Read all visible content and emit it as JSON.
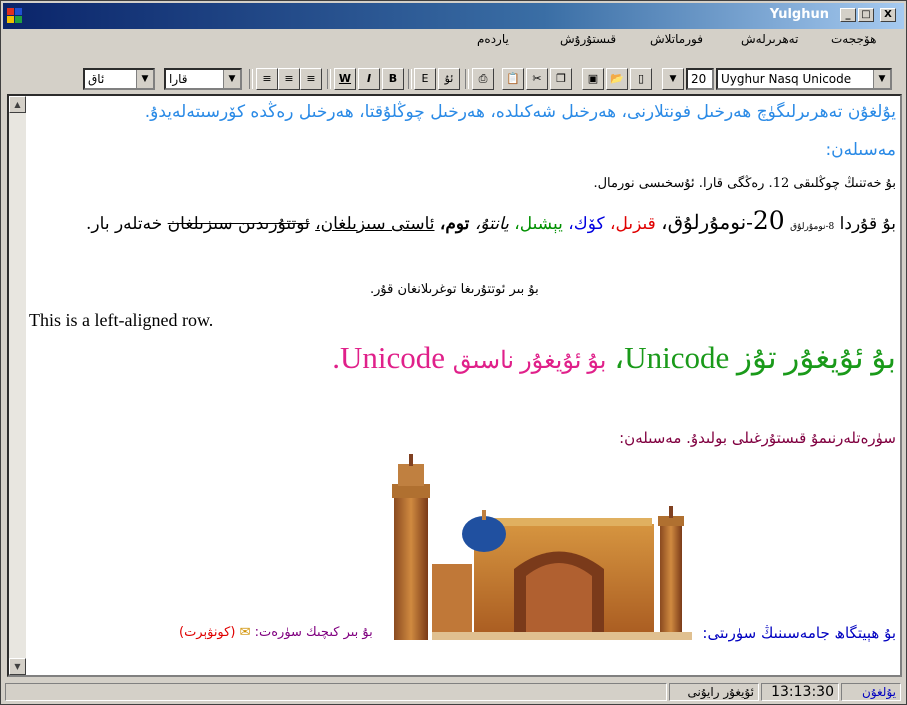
{
  "window": {
    "title": "Yulghun",
    "controls": {
      "minimize": "_",
      "maximize": "□",
      "close": "X"
    },
    "icon_colors": [
      "#e03020",
      "#2050d0",
      "#f0c000",
      "#20a040"
    ]
  },
  "menu": {
    "items": [
      "ھۆججەت",
      "تەھرىرلەش",
      "فورماتلاش",
      "قىستۇرۇش",
      "ياردەم"
    ]
  },
  "toolbar": {
    "font_name": "Uyghur Nasq Unicode",
    "font_size": "20",
    "color_label": "قارا",
    "bgcolor_label": "ئاق",
    "buttons": {
      "bold": "B",
      "italic": "I",
      "underline": "W",
      "edit": "E",
      "u": "ئۇ"
    }
  },
  "editor": {
    "line1": "يۇلغۇن تەھرىرلىگۈچ ھەرخىل فونتلارنى، ھەرخىل شەكىلدە، ھەرخىل چوڭلۇقتا، ھەرخىل رەڭدە كۆرسىتەلەيدۇ.",
    "line2": "مەسىلەن:",
    "line3": "بۇ خەتنىڭ چوڭلىقى 12. رەڭگى قارا. ئۇسخىسى نورمال.",
    "line4": {
      "prefix": "بۇ قۇردا",
      "tiny_num": "8",
      "tiny_word": "-نومۇرلۇق",
      "big_num": "20",
      "big_word": "-نومۇرلۇق،",
      "red": "قىزىل،",
      "blue": "كۆك،",
      "green": "يېشىل،",
      "italic": "يانتۇ،",
      "bold": "توم،",
      "underline": "ئاستى سىزىلغان،",
      "strike": "ئوتتۇرىدىن سىزىلغان",
      "suffix": "خەتلەر بار."
    },
    "centered": "بۇ بىر ئوتتۇرىغا توغرىلانغان قۇر.",
    "left_aligned": "This is a left-aligned row.",
    "big_line": {
      "green_part": "بۇ ئۇيغۇر تۇز",
      "green_unicode": "Unicode",
      "comma": "،",
      "pink_part": "بۇ ئۇيغۇر ناسىق",
      "pink_unicode": "Unicode."
    },
    "image_line": "سۈرەتلەرنىمۇ قىستۇرغىلى بولىدۇ. مەسىلەن:",
    "caption": "بۇ ھېيتگاھ جامەسىنىڭ سۈرىتى:",
    "small_image": "بۇ بىر كىچىك سۈرەت:",
    "envelope": "✉",
    "convert": "(كونۋېرت)"
  },
  "statusbar": {
    "mode": "يۇلغۇن",
    "time": "13:13:30",
    "kb": "ئۇيغۇر رايۇنى"
  }
}
